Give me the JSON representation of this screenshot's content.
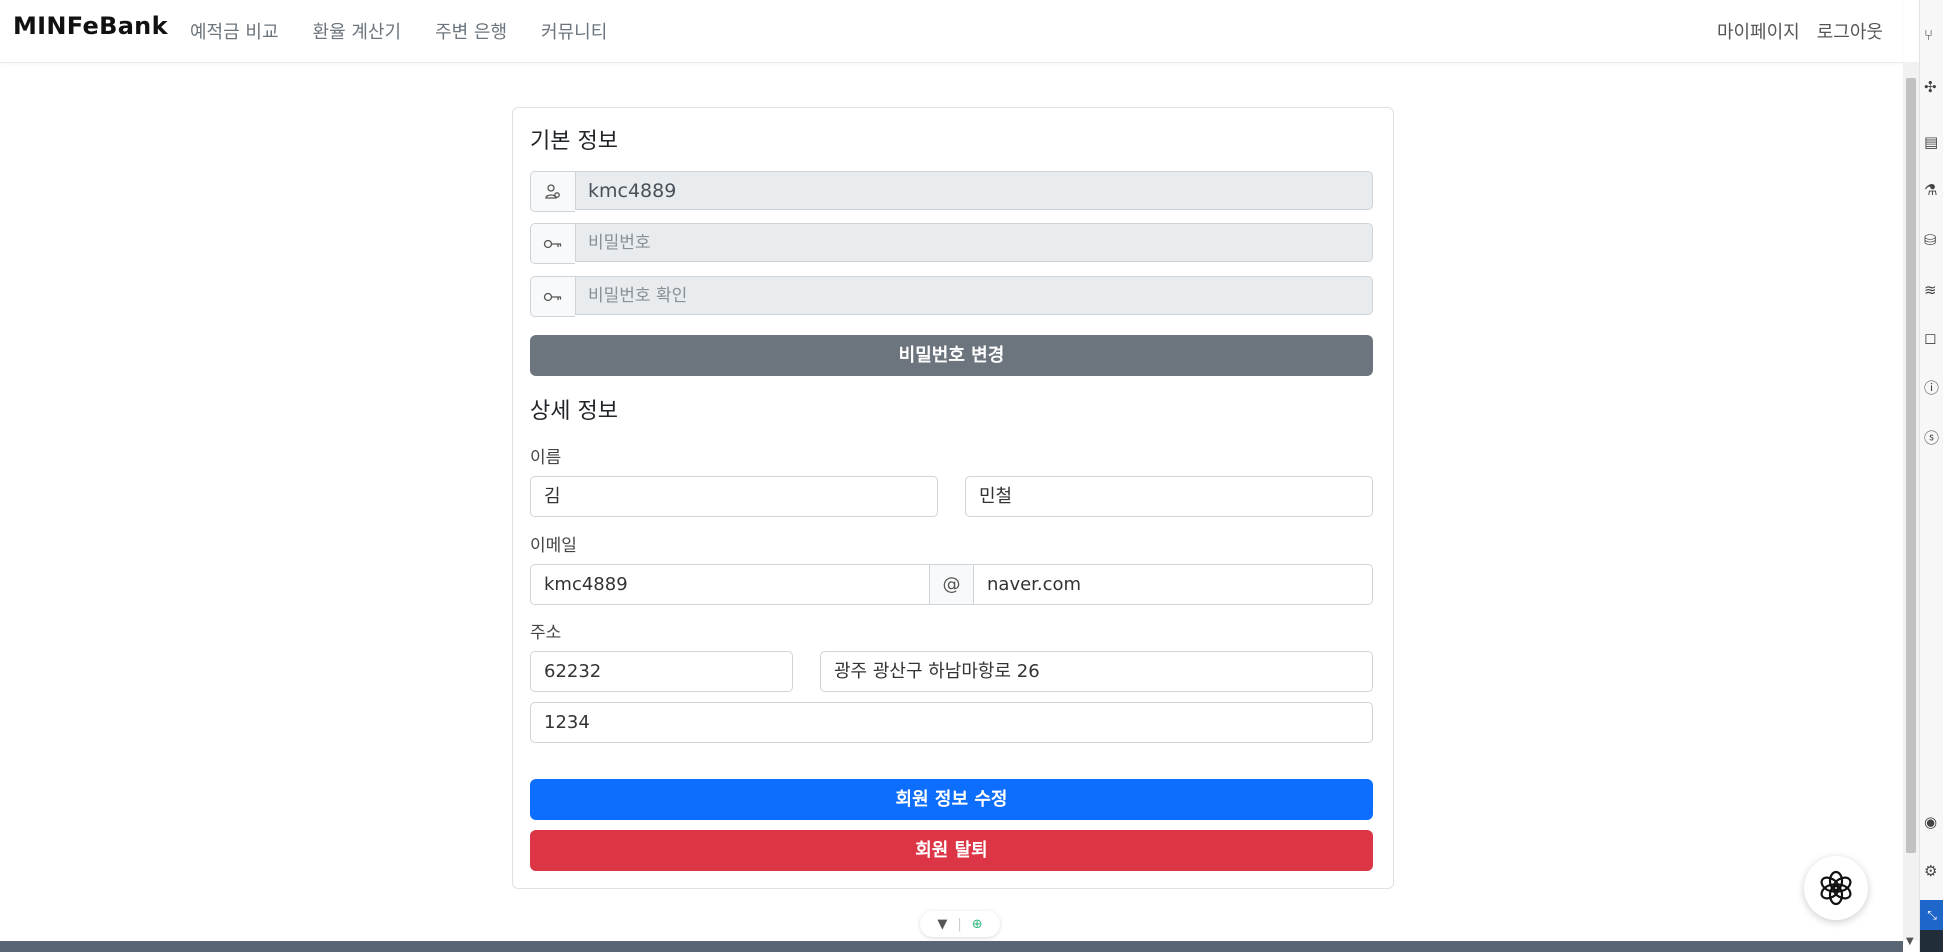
{
  "navbar": {
    "brand": "MINFeBank",
    "links": [
      "예적금 비교",
      "환율 계산기",
      "주변 은행",
      "커뮤니티"
    ],
    "right_links": [
      "마이페이지",
      "로그아웃"
    ]
  },
  "basic_info": {
    "title": "기본 정보",
    "user_id": "kmc4889",
    "password_placeholder": "비밀번호",
    "password_confirm_placeholder": "비밀번호 확인",
    "change_password_button": "비밀번호 변경",
    "icons": [
      "user-icon",
      "key-icon",
      "key-icon"
    ]
  },
  "detail_info": {
    "title": "상세 정보",
    "name_label": "이름",
    "last_name": "김",
    "first_name": "민철",
    "email_label": "이메일",
    "email_local": "kmc4889",
    "email_at": "@",
    "email_domain": "naver.com",
    "address_label": "주소",
    "postcode": "62232",
    "address": "광주 광산구 하남마항로 26",
    "address_detail": "1234"
  },
  "actions": {
    "update_button": "회원 정보 수정",
    "withdraw_button": "회원 탈퇴"
  },
  "colors": {
    "primary": "#0d6efd",
    "danger": "#dc3545",
    "secondary": "#6c757d"
  }
}
